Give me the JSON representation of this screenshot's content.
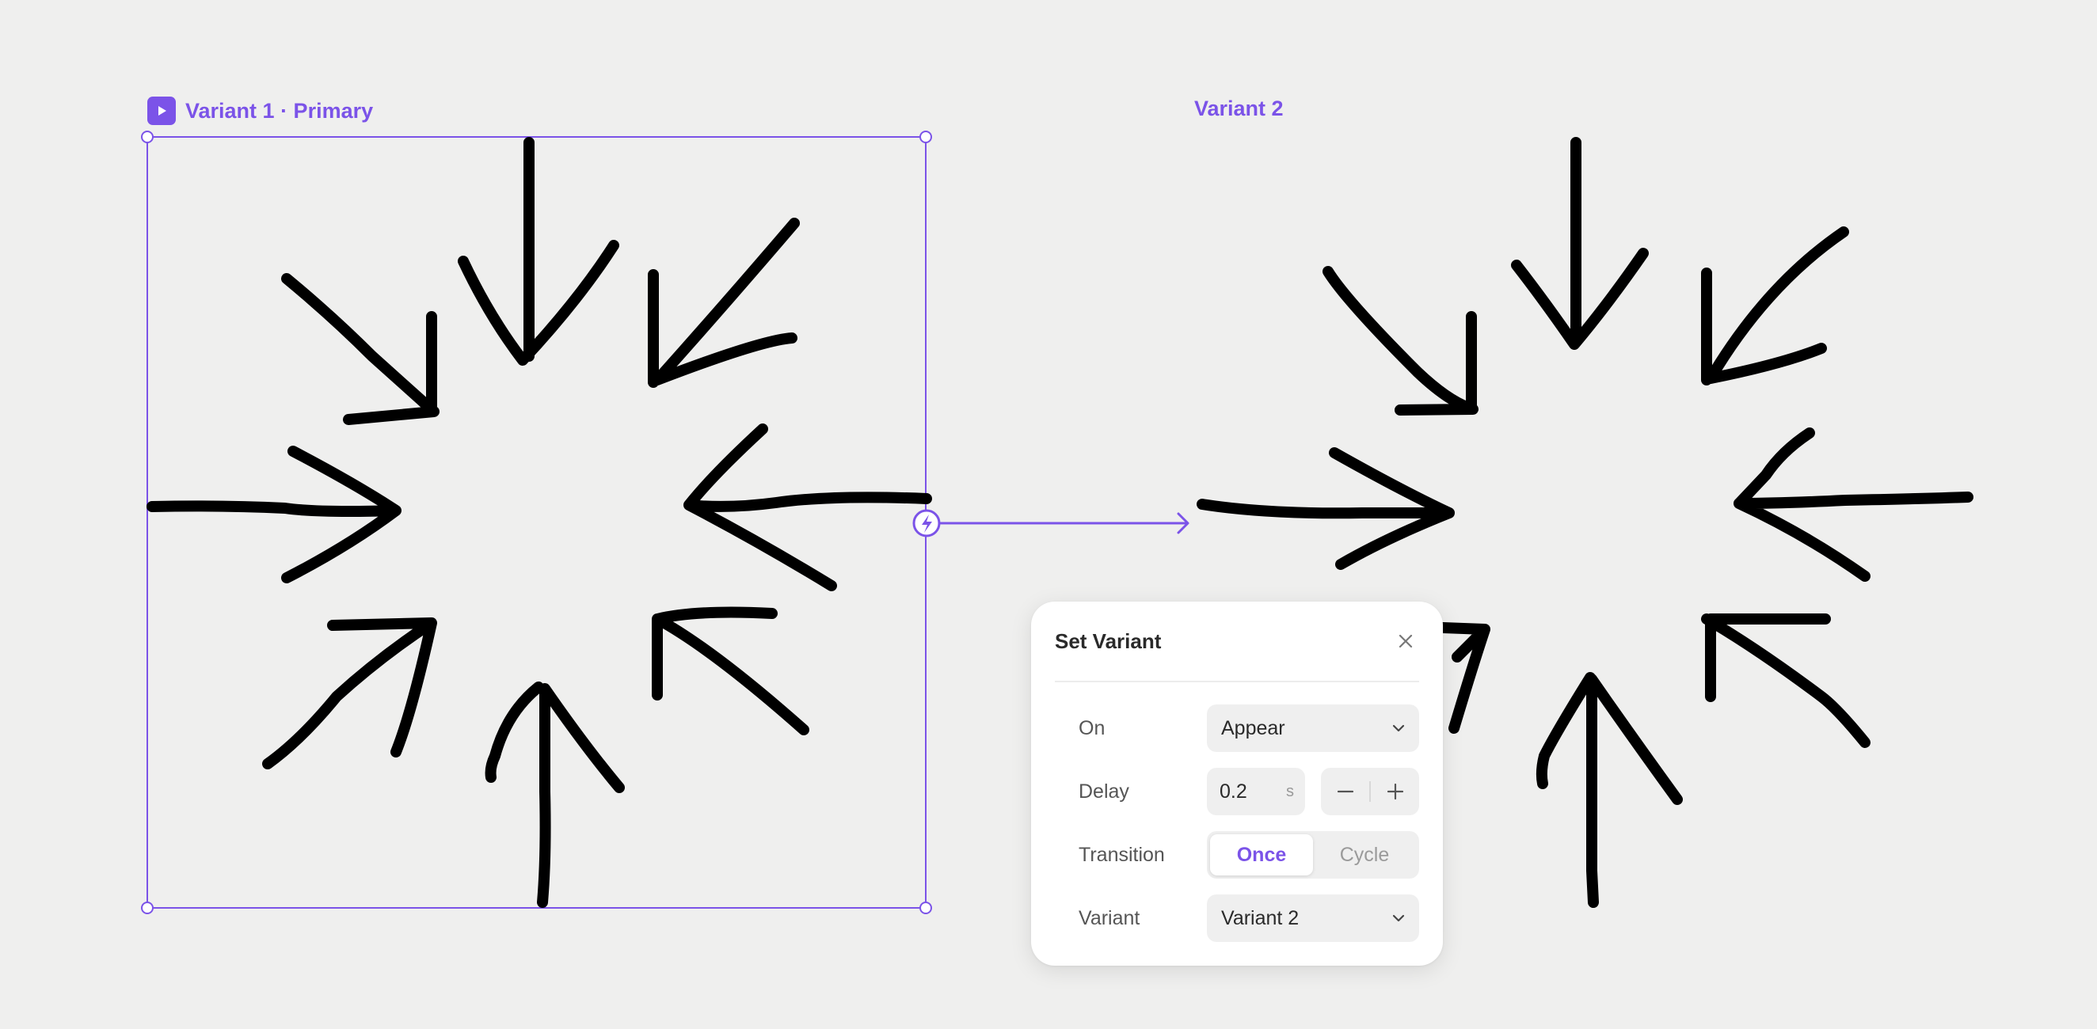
{
  "frames": {
    "variant1": {
      "label": "Variant 1 · Primary"
    },
    "variant2": {
      "label": "Variant 2"
    }
  },
  "panel": {
    "title": "Set Variant",
    "on": {
      "label": "On",
      "value": "Appear"
    },
    "delay": {
      "label": "Delay",
      "value": "0.2",
      "unit": "s"
    },
    "transition": {
      "label": "Transition",
      "options": [
        "Once",
        "Cycle"
      ],
      "selected": "Once"
    },
    "variant": {
      "label": "Variant",
      "value": "Variant 2"
    }
  },
  "colors": {
    "accent": "#7b53e8",
    "canvas_background": "#efefee",
    "stroke": "#000000",
    "panel_background": "#ffffff"
  },
  "icons": {
    "frame_badge": "play-icon",
    "trigger": "lightning-icon",
    "close": "close-icon",
    "dropdown": "chevron-down-icon",
    "decrement": "minus-icon",
    "increment": "plus-icon"
  }
}
